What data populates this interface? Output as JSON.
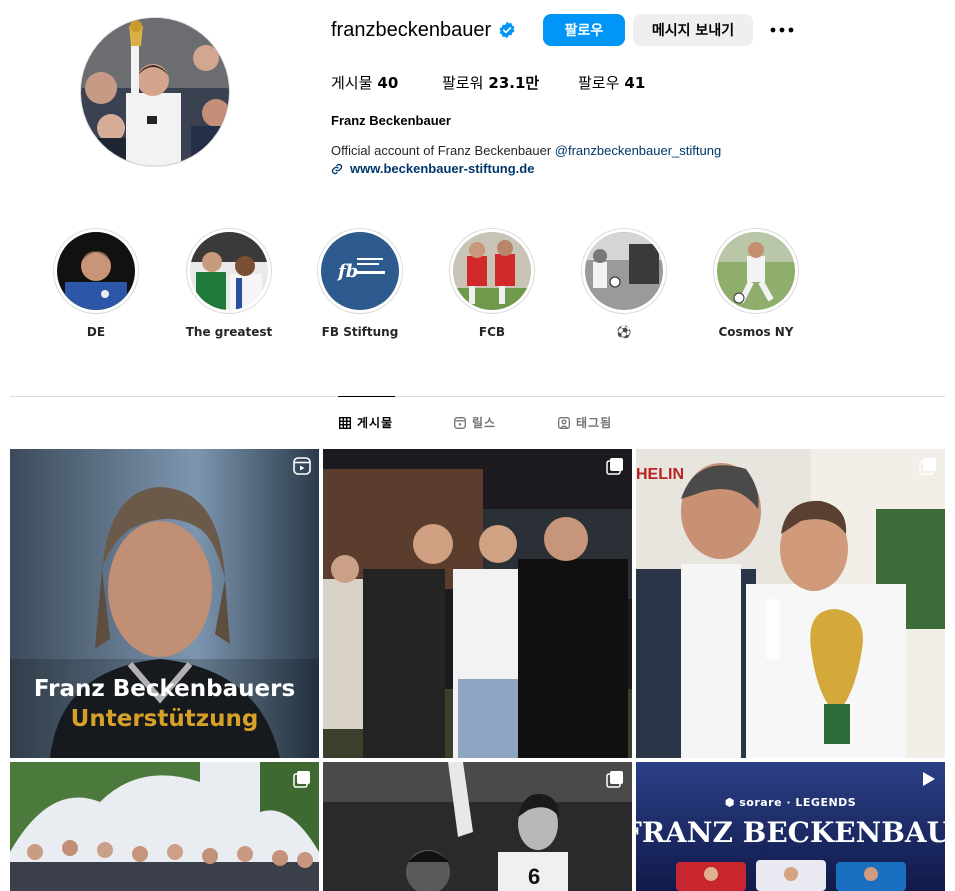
{
  "profile": {
    "username": "franzbeckenbauer",
    "full_name": "Franz Beckenbauer",
    "bio_text": "Official account of Franz Beckenbauer",
    "bio_mention": "@franzbeckenbauer_stiftung",
    "website": "www.beckenbauer-stiftung.de",
    "verified": true
  },
  "actions": {
    "follow_label": "팔로우",
    "message_label": "메시지 보내기"
  },
  "stats": {
    "posts_label": "게시물",
    "posts_value": "40",
    "followers_label": "팔로워",
    "followers_value": "23.1만",
    "following_label": "팔로우",
    "following_value": "41"
  },
  "highlights": [
    {
      "label": "DE"
    },
    {
      "label": "The greatest"
    },
    {
      "label": "FB Stiftung"
    },
    {
      "label": "FCB"
    },
    {
      "label": "⚽"
    },
    {
      "label": "Cosmos NY"
    }
  ],
  "tabs": {
    "posts": "게시물",
    "reels": "릴스",
    "tagged": "태그됨"
  },
  "posts": {
    "p1_line1": "Franz Beckenbauers",
    "p1_line2": "Unterstützung",
    "p6_brand": "⬢ sorare · LEGENDS",
    "p6_title": "FRANZ BECKENBAUER"
  },
  "colors": {
    "accent": "#0095f6",
    "verified": "#0095f6",
    "link": "#00376b",
    "secondary_button": "#efefef",
    "overlay_gold": "#d7a128"
  },
  "icons": {
    "verified": "verified-badge-icon",
    "more": "more-options-icon",
    "link": "link-icon",
    "grid": "grid-icon",
    "reels": "reels-icon",
    "tagged": "tagged-icon",
    "reel_badge": "reel-badge-icon",
    "carousel_badge": "carousel-badge-icon",
    "video_badge": "video-play-icon"
  }
}
